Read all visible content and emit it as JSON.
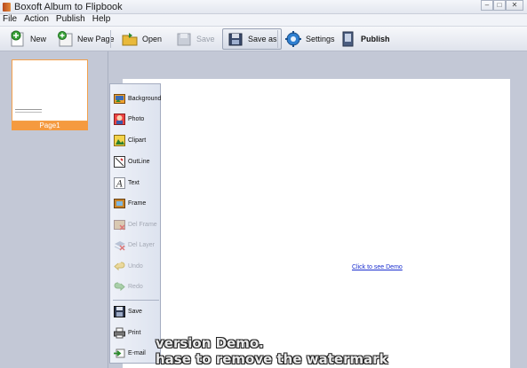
{
  "window": {
    "title": "Boxoft Album to Flipbook"
  },
  "menu": [
    "File",
    "Action",
    "Publish",
    "Help"
  ],
  "toolbar": {
    "new_label": "New",
    "new_page_label": "New Page",
    "open_label": "Open",
    "save_label": "Save",
    "save_as_label": "Save as",
    "settings_label": "Settings",
    "publish_label": "Publish"
  },
  "pages": [
    {
      "label": "Page1"
    }
  ],
  "palette": {
    "background": "Background",
    "photo": "Photo",
    "clipart": "Clipart",
    "outline": "OutLine",
    "text": "Text",
    "frame": "Frame",
    "del_frame": "Del Frame",
    "del_layer": "Del Layer",
    "undo": "Undo",
    "redo": "Redo",
    "save": "Save",
    "print": "Print",
    "email": "E-mail"
  },
  "canvas": {
    "demo_link": "Click to see Demo"
  },
  "watermark": {
    "line1": "version Demo.",
    "line2": "hase to remove the watermark"
  },
  "colors": {
    "accent": "#f59a3f",
    "link": "#1a2ecf",
    "panel": "#c3c8d6"
  }
}
